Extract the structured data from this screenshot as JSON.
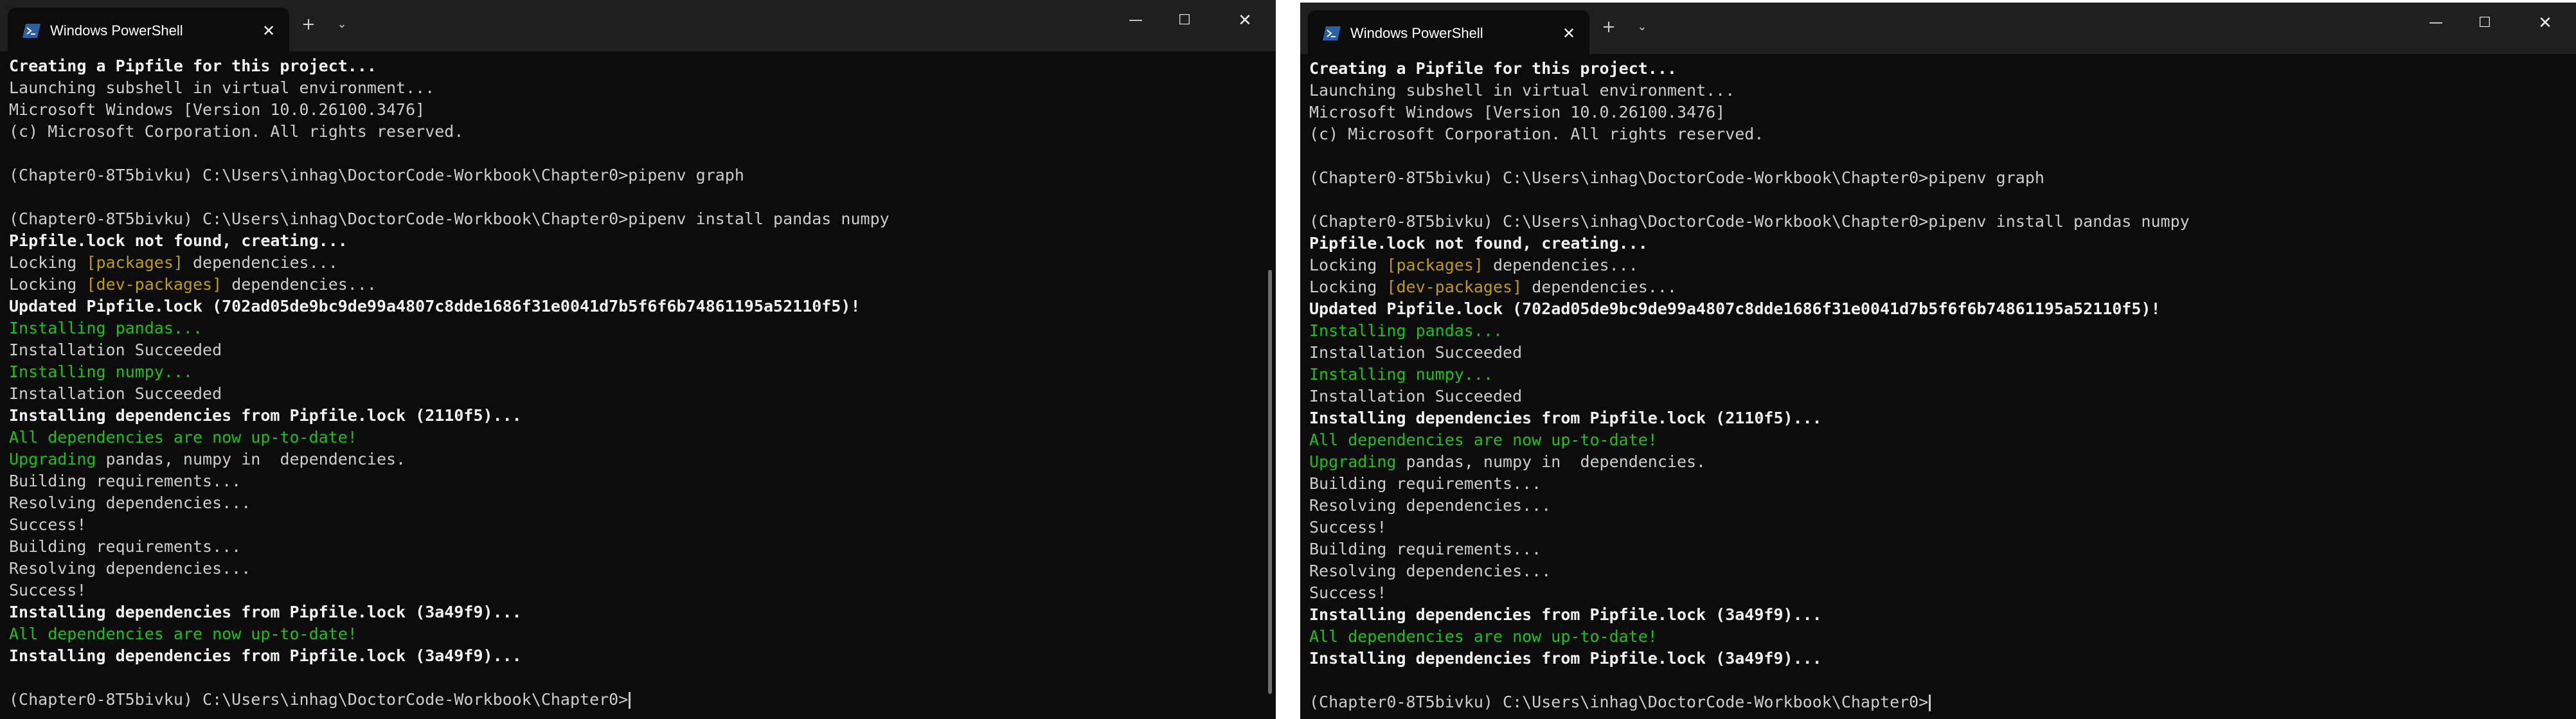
{
  "windows": [
    {
      "id": "left"
    },
    {
      "id": "right"
    }
  ],
  "titlebar": {
    "tab_title": "Windows PowerShell",
    "close_tab_glyph": "✕",
    "new_tab_glyph": "+",
    "dropdown_glyph": "⌄",
    "minimize_glyph": "—",
    "maximize_glyph": "☐",
    "close_window_glyph": "✕",
    "icon": "powershell-icon",
    "icon_color": "#2b5fa8"
  },
  "terminal": {
    "colors": {
      "background": "#0c0c0c",
      "text": "#cccccc",
      "bright": "#f2f2f2",
      "green": "#16c60c",
      "yellow": "#c19c00"
    },
    "lines": [
      "Creating a Pipfile for this project...",
      "Launching subshell in virtual environment...",
      "Microsoft Windows [Version 10.0.26100.3476]",
      "(c) Microsoft Corporation. All rights reserved.",
      "",
      "(Chapter0-8T5bivku) C:\\Users\\inhag\\DoctorCode-Workbook\\Chapter0>pipenv graph",
      "",
      "(Chapter0-8T5bivku) C:\\Users\\inhag\\DoctorCode-Workbook\\Chapter0>pipenv install pandas numpy",
      "Pipfile.lock not found, creating...",
      "Locking ",
      "Locking ",
      "Updated Pipfile.lock (702ad05de9bc9de99a4807c8dde1686f31e0041d7b5f6f6b74861195a52110f5)!",
      "Installing pandas...",
      "Installation Succeeded",
      "Installing numpy...",
      "Installation Succeeded",
      "Installing dependencies from Pipfile.lock (2110f5)...",
      "All dependencies are now up-to-date!",
      "Upgrading",
      "Building requirements...",
      "Resolving dependencies...",
      "Success!",
      "Building requirements...",
      "Resolving dependencies...",
      "Success!",
      "Installing dependencies from Pipfile.lock (3a49f9)...",
      "All dependencies are now up-to-date!",
      "Installing dependencies from Pipfile.lock (3a49f9)...",
      "",
      "(Chapter0-8T5bivku) C:\\Users\\inhag\\DoctorCode-Workbook\\Chapter0>"
    ],
    "segments": {
      "packages": "[packages]",
      "dev_packages": "[dev-packages]",
      "dependencies_tail": " dependencies...",
      "upgrading_tail": " pandas, numpy in  dependencies."
    }
  }
}
